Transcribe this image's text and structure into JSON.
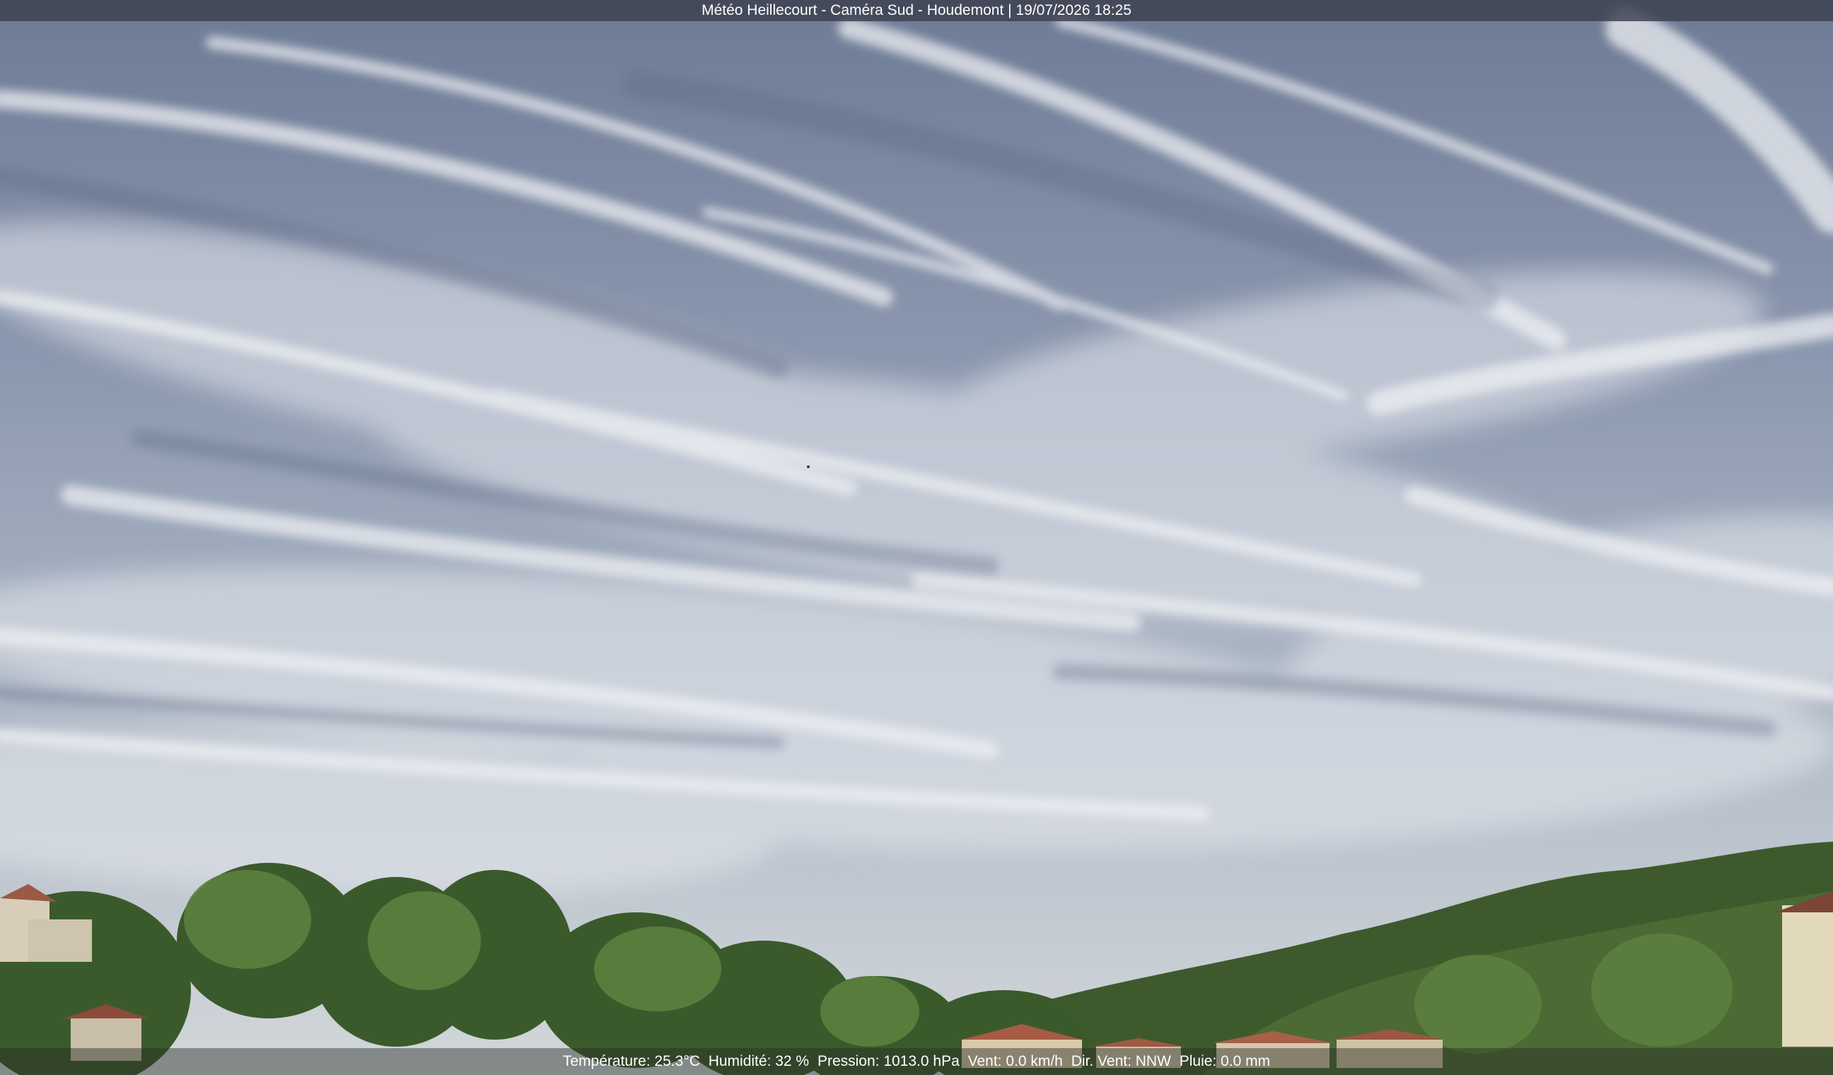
{
  "overlay": {
    "title": "Météo Heillecourt - Caméra Sud - Houdemont | 19/07/2026 18:25"
  },
  "weather": {
    "temperature": "Température: 25.3°C",
    "humidity": "Humidité: 32 %",
    "pressure": "Pression: 1013.0 hPa",
    "wind": "Vent: 0.0 km/h",
    "wind_dir": "Dir. Vent: NNW",
    "rain": "Pluie: 0.0 mm"
  },
  "colors": {
    "sky_top": "#6f7c97",
    "sky_bottom": "#c9d0d6",
    "cloud": "#e4e7ec",
    "foliage": "#3f5a2e",
    "roof": "#a65c44"
  }
}
